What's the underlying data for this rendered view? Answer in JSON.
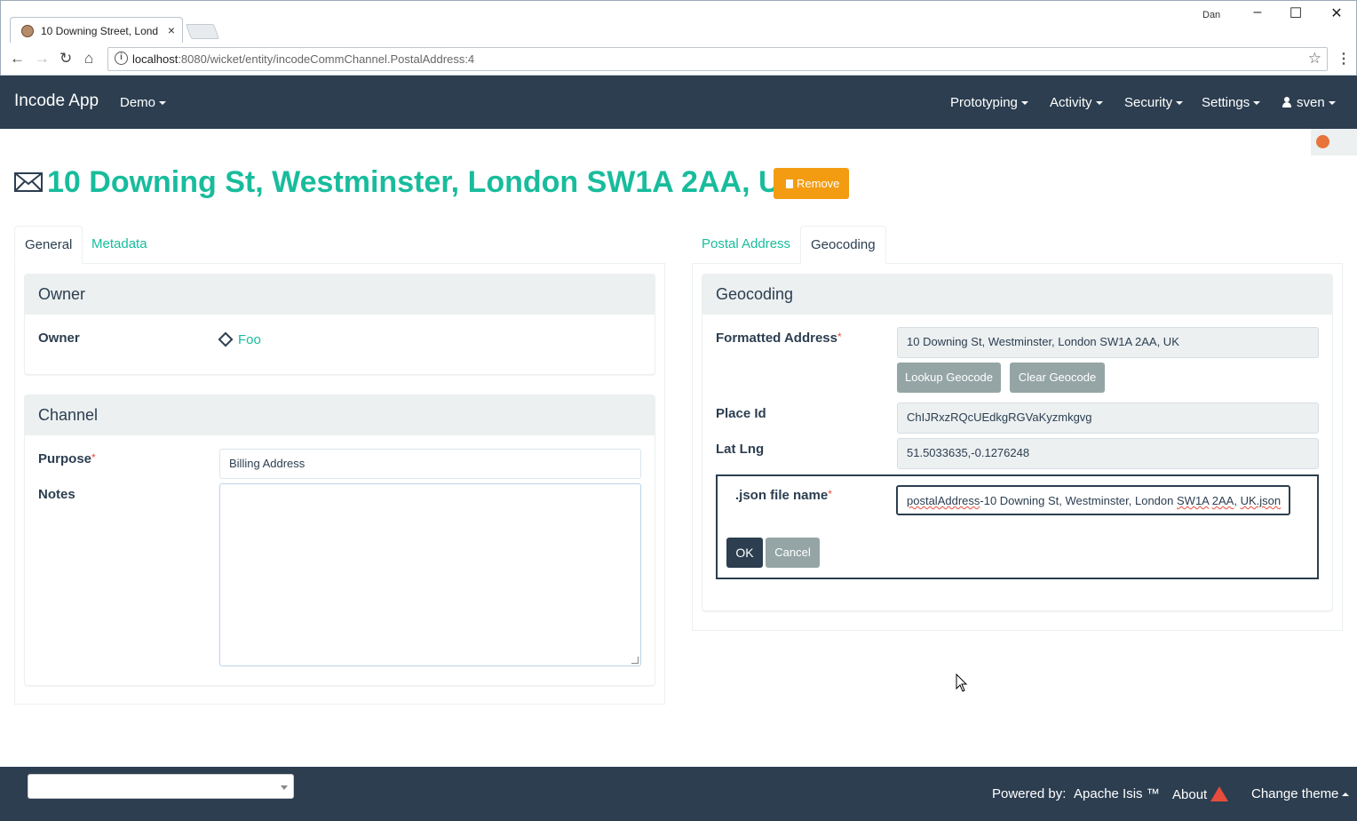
{
  "browser": {
    "tab_title": "10 Downing Street, Lond",
    "close_glyph": "×",
    "window_user": "Dan",
    "url_host": "localhost",
    "url_rest": ":8080/wicket/entity/incodeCommChannel.PostalAddress:4"
  },
  "navbar": {
    "brand": "Incode App",
    "demo": "Demo",
    "prototyping": "Prototyping",
    "activity": "Activity",
    "security": "Security",
    "settings": "Settings",
    "user": "sven"
  },
  "header": {
    "title": "10 Downing St, Westminster, London SW1A 2AA, UK",
    "remove_label": "Remove"
  },
  "left": {
    "tabs": [
      "General",
      "Metadata"
    ],
    "owner_panel": {
      "heading": "Owner",
      "owner_label": "Owner",
      "owner_value": "Foo"
    },
    "channel_panel": {
      "heading": "Channel",
      "purpose_label": "Purpose",
      "purpose_value": "Billing Address",
      "notes_label": "Notes",
      "notes_value": ""
    }
  },
  "right": {
    "tabs": [
      "Postal Address",
      "Geocoding"
    ],
    "geocoding_panel": {
      "heading": "Geocoding",
      "formatted_address_label": "Formatted Address",
      "formatted_address_value": "10 Downing St, Westminster, London SW1A 2AA, UK",
      "lookup_label": "Lookup Geocode",
      "clear_label": "Clear Geocode",
      "place_id_label": "Place Id",
      "place_id_value": "ChIJRxzRQcUEdkgRGVaKyzmkgvg",
      "lat_lng_label": "Lat Lng",
      "lat_lng_value": "51.5033635,-0.1276248"
    },
    "dialog": {
      "json_label": ".json file name",
      "json_value_prefix": "postalAddress",
      "json_value_mid": "-10 Downing St, Westminster, London ",
      "json_value_sw": "SW1A",
      "json_value_2aa": "2AA",
      "json_value_uk": "UK.json",
      "ok_label": "OK",
      "cancel_label": "Cancel"
    }
  },
  "footer": {
    "powered_by": "Powered by:",
    "apache_isis": "Apache Isis ™",
    "about": "About",
    "change_theme": "Change theme"
  },
  "required_mark": "*",
  "colors": {
    "navbar": "#2c3e50",
    "link": "#18bc9c",
    "remove": "#f39c12",
    "danger": "#e74c3c",
    "muted_button": "#95a5a6"
  }
}
